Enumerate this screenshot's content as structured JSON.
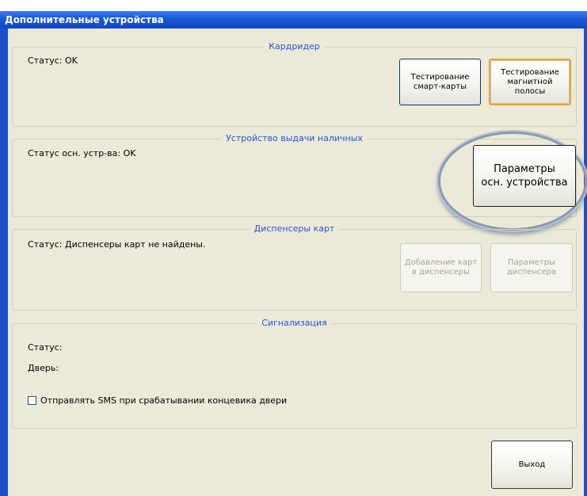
{
  "window": {
    "title": "Дополнительные устройства"
  },
  "cardreader": {
    "title": "Кардридер",
    "status": "Статус: OK",
    "btn_smartcard": "Тестирование\nсмарт-карты",
    "btn_magstripe": "Тестирование\nмагнитной\nполосы"
  },
  "cash_device": {
    "title": "Устройство выдачи наличных",
    "status": "Статус осн. устр-ва: OK",
    "btn_params": "Параметры\nосн. устройства"
  },
  "card_dispensers": {
    "title": "Диспенсеры карт",
    "status": "Статус:  Диспенсеры карт не найдены.",
    "btn_add": "Добавление карт\nв диспенсеры",
    "btn_params": "Параметры\nдиспенсера"
  },
  "alarm": {
    "title": "Сигнализация",
    "status_label": "Статус:",
    "door_label": "Дверь:",
    "sms_checkbox_label": "Отправлять SMS при срабатывании концевика двери"
  },
  "footer": {
    "exit_label": "Выход"
  }
}
